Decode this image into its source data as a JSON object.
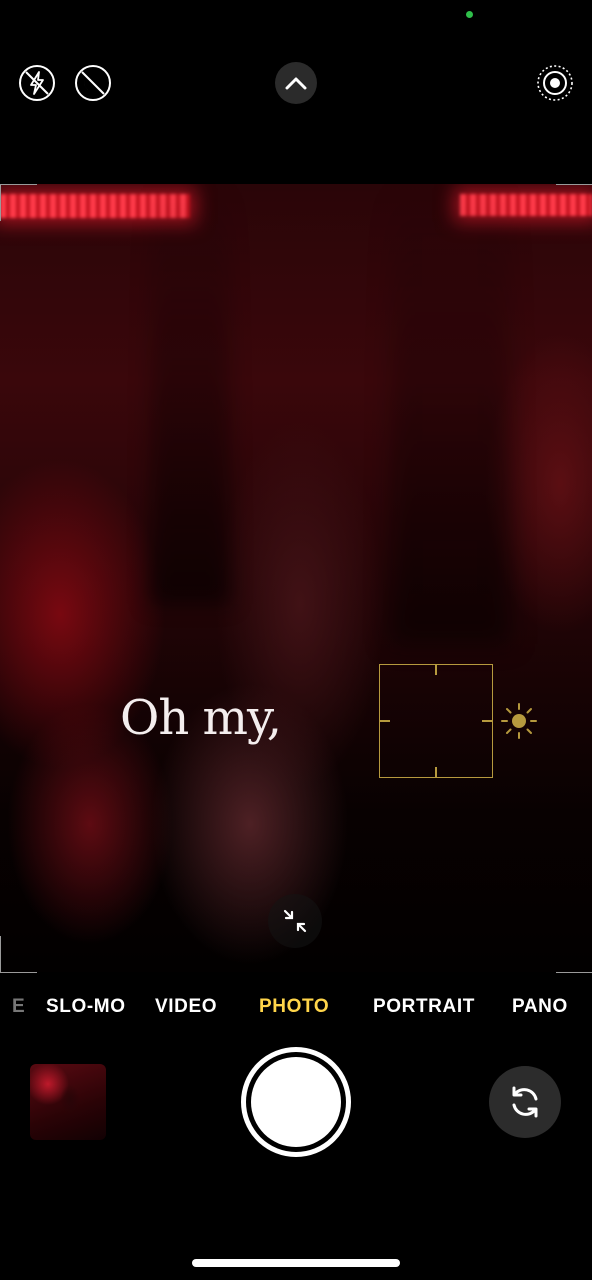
{
  "status": {
    "camera_indicator_color": "#2fbf4a"
  },
  "top_bar": {
    "icons": [
      "flash-off-icon",
      "live-photo-off-icon",
      "chevron-up-icon",
      "live-photo-icon"
    ]
  },
  "viewfinder": {
    "overlay_text": "Oh my,",
    "focus_color": "#b69a3e"
  },
  "modes": {
    "items": [
      "E",
      "SLO-MO",
      "VIDEO",
      "PHOTO",
      "PORTRAIT",
      "PANO"
    ],
    "selected": "PHOTO",
    "selected_color": "#ffd54a"
  },
  "controls": {
    "icons": [
      "thumbnail",
      "shutter-button",
      "camera-flip-icon"
    ]
  }
}
